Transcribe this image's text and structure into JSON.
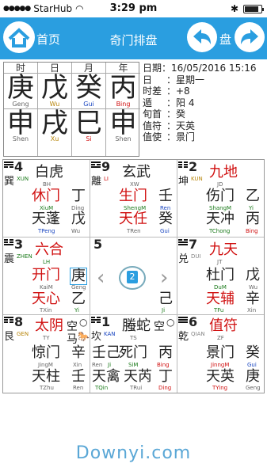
{
  "status": {
    "carrier": "StarHub",
    "time": "3:29 pm"
  },
  "nav": {
    "home": "首页",
    "title": "奇门排盘",
    "pan": "盘"
  },
  "pillars": [
    {
      "head": "时",
      "stem": "庚",
      "stem_pin": "Geng",
      "branch": "申",
      "branch_pin": "Shen"
    },
    {
      "head": "日",
      "stem": "戊",
      "stem_pin": "Wu",
      "branch": "戌",
      "branch_pin": "Xu"
    },
    {
      "head": "月",
      "stem": "癸",
      "stem_pin": "Gui",
      "branch": "巳",
      "branch_pin": "Si"
    },
    {
      "head": "年",
      "stem": "丙",
      "stem_pin": "Bing",
      "branch": "申",
      "branch_pin": "Shen"
    }
  ],
  "info": {
    "l1": "日期：16/05/2016 15:16",
    "l2k": "日",
    "l2": "：星期一",
    "l3k": "时差",
    "l3": "：+8",
    "l4k": "遁",
    "l4": "：阳 4",
    "l5k": "旬首",
    "l5": "：癸",
    "l6k": "值符",
    "l6": "：天英",
    "l7k": "值使",
    "l7": "：景门"
  },
  "cells": {
    "c4": {
      "num": "4",
      "gua": "巽",
      "gpin": "XUN",
      "god": "白虎",
      "god_pin": "BH",
      "door": "休门",
      "door_pin": "XiuM",
      "dstem": "丁",
      "dstem_pin": "Ding",
      "star": "天蓬",
      "star_pin": "TPeng",
      "sstem": "戊",
      "sstem_pin": "Wu"
    },
    "c9": {
      "num": "9",
      "gua": "離",
      "gpin": "LI",
      "god": "玄武",
      "god_pin": "XW",
      "door": "生门",
      "door_pin": "ShengM",
      "dstem": "壬",
      "dstem_pin": "Ren",
      "star": "天任",
      "star_pin": "TRen",
      "sstem": "癸",
      "sstem_pin": "Gui"
    },
    "c2": {
      "num": "2",
      "gua": "坤",
      "gpin": "KUN",
      "god": "九地",
      "god_pin": "JD",
      "door": "伤门",
      "door_pin": "ShangM",
      "dstem": "乙",
      "dstem_pin": "Yi",
      "star": "天冲",
      "star_pin": "TChong",
      "sstem": "丙",
      "sstem_pin": "Bing"
    },
    "c3": {
      "num": "3",
      "gua": "震",
      "gpin": "ZHEN",
      "god": "六合",
      "god_pin": "LH",
      "door": "开门",
      "door_pin": "KaiM",
      "dstem": "庚",
      "dstem_pin": "Geng",
      "star": "天心",
      "star_pin": "TXin",
      "sstem": "乙",
      "sstem_pin": "Yi"
    },
    "c5": {
      "num": "5",
      "sstem": "己",
      "sstem_pin": "Ji",
      "badge": "2"
    },
    "c7": {
      "num": "7",
      "gua": "兑",
      "gpin": "DUI",
      "god": "九天",
      "god_pin": "JT",
      "door": "杜门",
      "door_pin": "DuM",
      "dstem": "戊",
      "dstem_pin": "Wu",
      "star": "天辅",
      "star_pin": "TFu",
      "sstem": "辛",
      "sstem_pin": "Xin"
    },
    "c8": {
      "num": "8",
      "gua": "艮",
      "gpin": "GEN",
      "god": "太阴",
      "god_pin": "TY",
      "kong": "空",
      "ma": "马",
      "door": "惊门",
      "door_pin": "JingM",
      "dstem": "辛",
      "dstem_pin": "Xin",
      "star": "天柱",
      "star_pin": "TZhu",
      "sstem": "壬",
      "sstem_pin": "Ren"
    },
    "c1": {
      "num": "1",
      "gua": "坎",
      "gpin": "KAN",
      "god": "螣蛇",
      "god_pin": "TS",
      "kong": "空",
      "door": "死门",
      "door_pin": "SiM",
      "dstem2": "己",
      "dstem2_pin": "Ji",
      "dstem": "丙",
      "dstem_pin": "Bing",
      "star": "天禽",
      "star_pin": "TQin",
      "star2": "天芮",
      "star2_pin": "TRui",
      "sstem2": "丁",
      "sstem2_pin": "Ding",
      "pre": "壬",
      "pre_pin": "Ren"
    },
    "c6": {
      "num": "6",
      "gua": "乾",
      "gpin": "QIAN",
      "god": "值符",
      "god_pin": "ZF",
      "door": "景门",
      "door_pin": "JinngM",
      "dstem": "癸",
      "dstem_pin": "Gui",
      "star": "天英",
      "star_pin": "TYing",
      "sstem": "庚",
      "sstem_pin": "Geng"
    }
  },
  "footer": "Downyi.com"
}
